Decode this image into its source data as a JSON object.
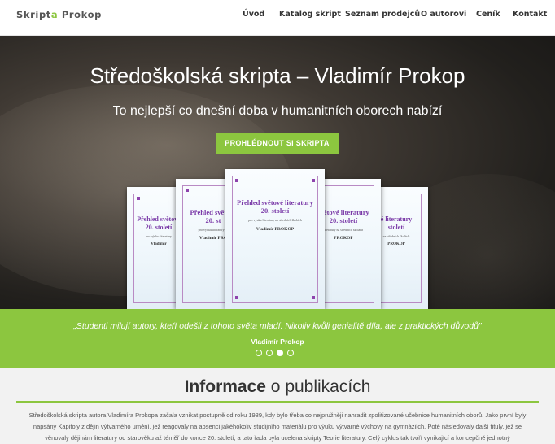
{
  "header": {
    "logo_main": "Skript",
    "logo_accent": "a",
    "logo_rest": " Prokop",
    "nav": [
      {
        "label": "Úvod"
      },
      {
        "label": "Katalog skript"
      },
      {
        "label": "Seznam prodejců"
      },
      {
        "label": "O autorovi"
      },
      {
        "label": "Ceník"
      },
      {
        "label": "Kontakt"
      }
    ]
  },
  "hero": {
    "title": "Středoškolská skripta – Vladimír Prokop",
    "subtitle": "To nejlepší co dnešní doba v humanitních oborech nabízí",
    "button_label": "PROHLÉDNOUT SI SKRIPTA"
  },
  "books": [
    {
      "title1": "Přehled světové",
      "title2": "20. století",
      "subtitle": "pro výuku literatury",
      "author": "Vladimír"
    },
    {
      "title1": "Přehled světové",
      "title2": "20. st",
      "subtitle": "pro výuku literatury na",
      "author": "Vladimír PRO"
    },
    {
      "title1": "Přehled světové literatury",
      "title2": "20. století",
      "subtitle": "pro výuku literatury na středních školách",
      "author": "Vladimír PROKOP"
    },
    {
      "title1": "světové literatury",
      "title2": "20. století",
      "subtitle": "literatury na středních školách",
      "author": "PROKOP"
    },
    {
      "title1": "é literatury",
      "title2": "století",
      "subtitle": "na středních školách",
      "author": "PROKOP"
    }
  ],
  "quote": {
    "text": "„Studenti milují autory, kteří odešli z tohoto světa mladí. Nikoliv kvůli genialitě díla, ale z praktických důvodů\"",
    "author": "Vladimír Prokop",
    "slides_total": 4,
    "active_slide": 3
  },
  "info": {
    "title_bold": "Informace",
    "title_rest": " o publikacích",
    "paragraph": "Středoškolská skripta autora Vladimíra Prokopa začala vznikat postupně od roku 1989, kdy bylo třeba co nejpružněji nahradit zpolitizované učebnice humanitních oborů. Jako první byly napsány Kapitoly z dějin výtvarného umění, jež reagovaly na absenci jakéhokoliv studijního materiálu pro výuku výtvarné výchovy na gymnáziích. Poté následovaly další tituly, jež se věnovaly dějinám literatury od starověku až téměř do konce 20. století, a tato řada byla ucelena skripty Teorie literatury. Celý cyklus tak tvoří vynikající a koncepčně jednotný"
  },
  "colors": {
    "accent": "#8cc63f",
    "book_title": "#7a3aa8"
  }
}
